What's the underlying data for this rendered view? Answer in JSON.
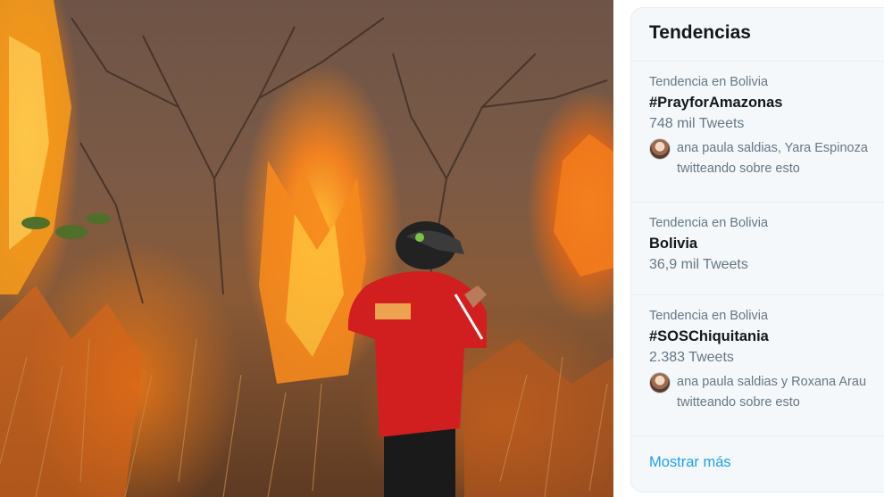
{
  "photo": {
    "description_icon": "wildfire-photo"
  },
  "trends_panel": {
    "title": "Tendencias",
    "items": [
      {
        "context": "Tendencia en Bolivia",
        "name": "#PrayforAmazonas",
        "count": "748 mil Tweets",
        "users_line1": "ana paula saldias, Yara Espinoza",
        "users_line2": "twitteando sobre esto"
      },
      {
        "context": "Tendencia en Bolivia",
        "name": "Bolivia",
        "count": "36,9 mil Tweets"
      },
      {
        "context": "Tendencia en Bolivia",
        "name": "#SOSChiquitania",
        "count": "2.383 Tweets",
        "users_line1": "ana paula saldias y Roxana Arau",
        "users_line2": "twitteando sobre esto"
      }
    ],
    "show_more": "Mostrar más"
  },
  "colors": {
    "link": "#1da1f2",
    "secondary_text": "#657786",
    "primary_text": "#14171a",
    "panel_bg": "#f5f8fa"
  }
}
